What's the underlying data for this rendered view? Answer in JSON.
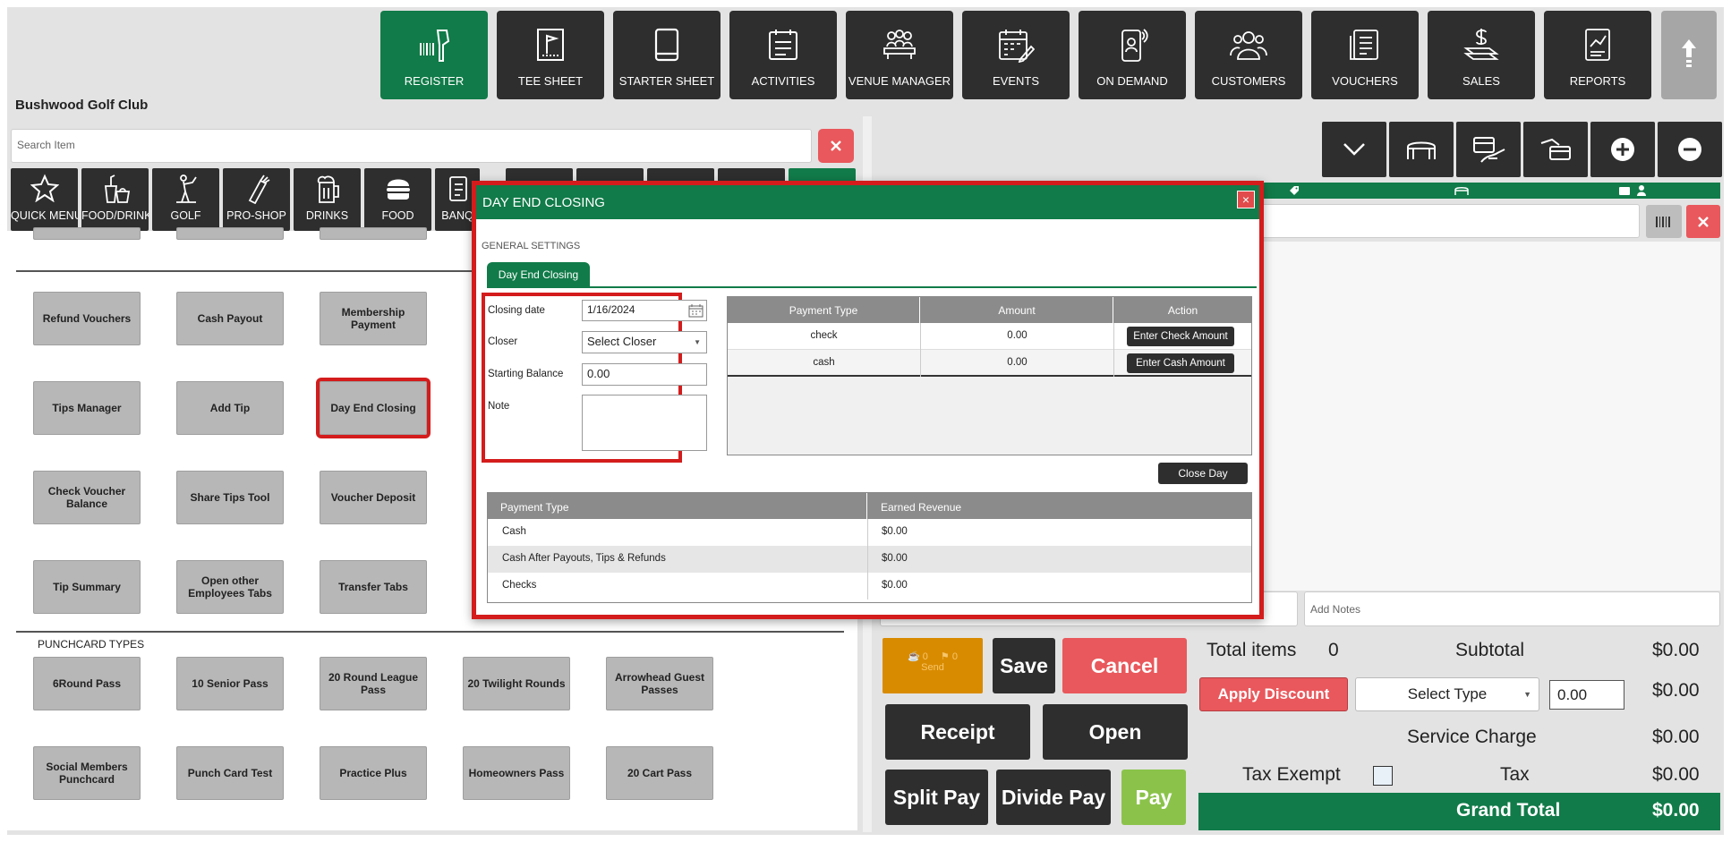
{
  "nav": {
    "items": [
      {
        "label": "REGISTER",
        "icon": "barcode-scanner-icon"
      },
      {
        "label": "TEE SHEET",
        "icon": "flag-card-icon"
      },
      {
        "label": "STARTER SHEET",
        "icon": "tablet-icon"
      },
      {
        "label": "ACTIVITIES",
        "icon": "checklist-icon"
      },
      {
        "label": "VENUE MANAGER",
        "icon": "meeting-table-icon"
      },
      {
        "label": "EVENTS",
        "icon": "calendar-edit-icon"
      },
      {
        "label": "ON DEMAND",
        "icon": "phone-person-icon"
      },
      {
        "label": "CUSTOMERS",
        "icon": "users-icon"
      },
      {
        "label": "VOUCHERS",
        "icon": "voucher-icon"
      },
      {
        "label": "SALES",
        "icon": "money-hand-icon"
      },
      {
        "label": "REPORTS",
        "icon": "report-chart-icon"
      }
    ],
    "active_color": "#117b49"
  },
  "club_name": "Bushwood Golf Club",
  "search": {
    "placeholder": "Search Item"
  },
  "categories": [
    {
      "label": "QUICK MENU",
      "icon": "star-icon"
    },
    {
      "label": "FOOD/DRINK",
      "icon": "food-drink-icon"
    },
    {
      "label": "GOLF",
      "icon": "golfer-icon"
    },
    {
      "label": "PRO-SHOP",
      "icon": "golf-bag-icon"
    },
    {
      "label": "DRINKS",
      "icon": "beer-icon"
    },
    {
      "label": "FOOD",
      "icon": "burger-icon"
    },
    {
      "label": "BANQ",
      "icon": "banquet-icon"
    }
  ],
  "tiles": {
    "row1": [
      "Refund Vouchers",
      "Cash Payout",
      "Membership Payment"
    ],
    "row2": [
      "Tips Manager",
      "Add Tip",
      "Day End Closing"
    ],
    "row3": [
      "Check Voucher Balance",
      "Share Tips Tool",
      "Voucher Deposit"
    ],
    "row4": [
      "Tip Summary",
      "Open other Employees Tabs",
      "Transfer Tabs"
    ]
  },
  "punchcard": {
    "heading": "PUNCHCARD TYPES",
    "row1": [
      "6Round Pass",
      "10 Senior Pass",
      "20 Round League Pass",
      "20 Twilight Rounds",
      "Arrowhead Guest Passes"
    ],
    "row2": [
      "Social Members Punchcard",
      "Punch Card Test",
      "Practice Plus",
      "Homeowners Pass",
      "20 Cart Pass"
    ]
  },
  "right": {
    "notes_placeholder": "Add Notes",
    "send": {
      "count1": "0",
      "count2": "0",
      "label": "Send"
    },
    "save": "Save",
    "cancel": "Cancel",
    "receipt": "Receipt",
    "open": "Open",
    "split_pay": "Split Pay",
    "divide_pay": "Divide Pay",
    "pay": "Pay",
    "total_items_label": "Total items",
    "total_items_value": "0",
    "subtotal_label": "Subtotal",
    "subtotal_value": "$0.00",
    "apply_discount": "Apply Discount",
    "select_type": "Select Type",
    "discount_value": "0.00",
    "discount_amount": "$0.00",
    "service_charge_label": "Service Charge",
    "service_charge_value": "$0.00",
    "tax_exempt_label": "Tax Exempt",
    "tax_label": "Tax",
    "tax_value": "$0.00",
    "grand_total_label": "Grand Total",
    "grand_total_value": "$0.00"
  },
  "modal": {
    "title": "DAY END CLOSING",
    "close_glyph": "×",
    "section": "GENERAL SETTINGS",
    "tab": "Day End Closing",
    "closing_date_label": "Closing date",
    "closing_date_value": "1/16/2024",
    "closer_label": "Closer",
    "closer_value": "Select Closer",
    "starting_balance_label": "Starting Balance",
    "starting_balance_value": "0.00",
    "note_label": "Note",
    "payments": {
      "headers": [
        "Payment Type",
        "Amount",
        "Action"
      ],
      "rows": [
        {
          "type": "check",
          "amount": "0.00",
          "action": "Enter Check Amount"
        },
        {
          "type": "cash",
          "amount": "0.00",
          "action": "Enter Cash Amount"
        }
      ]
    },
    "close_day": "Close Day",
    "revenue": {
      "headers": [
        "Payment Type",
        "Earned Revenue"
      ],
      "rows": [
        {
          "type": "Cash",
          "value": "$0.00"
        },
        {
          "type": "Cash After Payouts, Tips & Refunds",
          "value": "$0.00"
        },
        {
          "type": "Checks",
          "value": "$0.00"
        }
      ]
    }
  },
  "colors": {
    "green": "#117b49",
    "dark": "#2e2e2e",
    "red": "#e9585c",
    "highlight": "#d41c1c",
    "send_orange": "#d98b00",
    "pay_green": "#8bc34a"
  }
}
